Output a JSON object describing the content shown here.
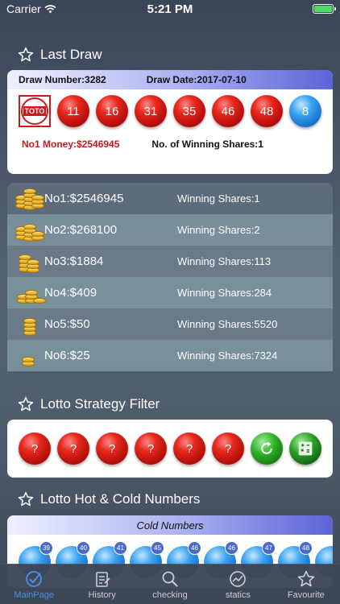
{
  "status": {
    "carrier": "Carrier",
    "time": "5:21 PM",
    "battery_level": 1.0
  },
  "sections": {
    "last_draw": "Last Draw",
    "strategy": "Lotto Strategy Filter",
    "hot_cold": "Lotto Hot & Cold Numbers"
  },
  "last_draw": {
    "draw_number": "Draw Number:3282",
    "draw_date": "Draw Date:2017-07-10",
    "logo_text": "TOTO",
    "numbers": [
      "11",
      "16",
      "31",
      "35",
      "46",
      "48"
    ],
    "bonus": "8",
    "no1_money": "No1 Money:$2546945",
    "winning_shares": "No. of Winning Shares:1"
  },
  "prizes": [
    {
      "label": "No1:$2546945",
      "shares": "Winning Shares:1"
    },
    {
      "label": "No2:$268100",
      "shares": "Winning Shares:2"
    },
    {
      "label": "No3:$1884",
      "shares": "Winning Shares:113"
    },
    {
      "label": "No4:$409",
      "shares": "Winning Shares:284"
    },
    {
      "label": "No5:$50",
      "shares": "Winning Shares:5520"
    },
    {
      "label": "No6:$25",
      "shares": "Winning Shares:7324"
    }
  ],
  "strategy": {
    "placeholders": [
      "?",
      "?",
      "?",
      "?",
      "?",
      "?"
    ]
  },
  "hot_cold": {
    "header": "Cold Numbers",
    "badges": [
      "39",
      "40",
      "41",
      "45",
      "46",
      "46",
      "47",
      "48",
      "49",
      "49"
    ]
  },
  "tabs": [
    {
      "label": "MainPage",
      "icon": "check-circle-icon"
    },
    {
      "label": "History",
      "icon": "clipboard-icon"
    },
    {
      "label": "checking",
      "icon": "search-icon"
    },
    {
      "label": "statics",
      "icon": "chart-icon"
    },
    {
      "label": "Favourite",
      "icon": "star-icon"
    }
  ],
  "colors": {
    "accent": "#4a90e2",
    "ball_red": "#d01c16",
    "ball_blue": "#1a7dd6",
    "money_red": "#cc1a1a"
  }
}
